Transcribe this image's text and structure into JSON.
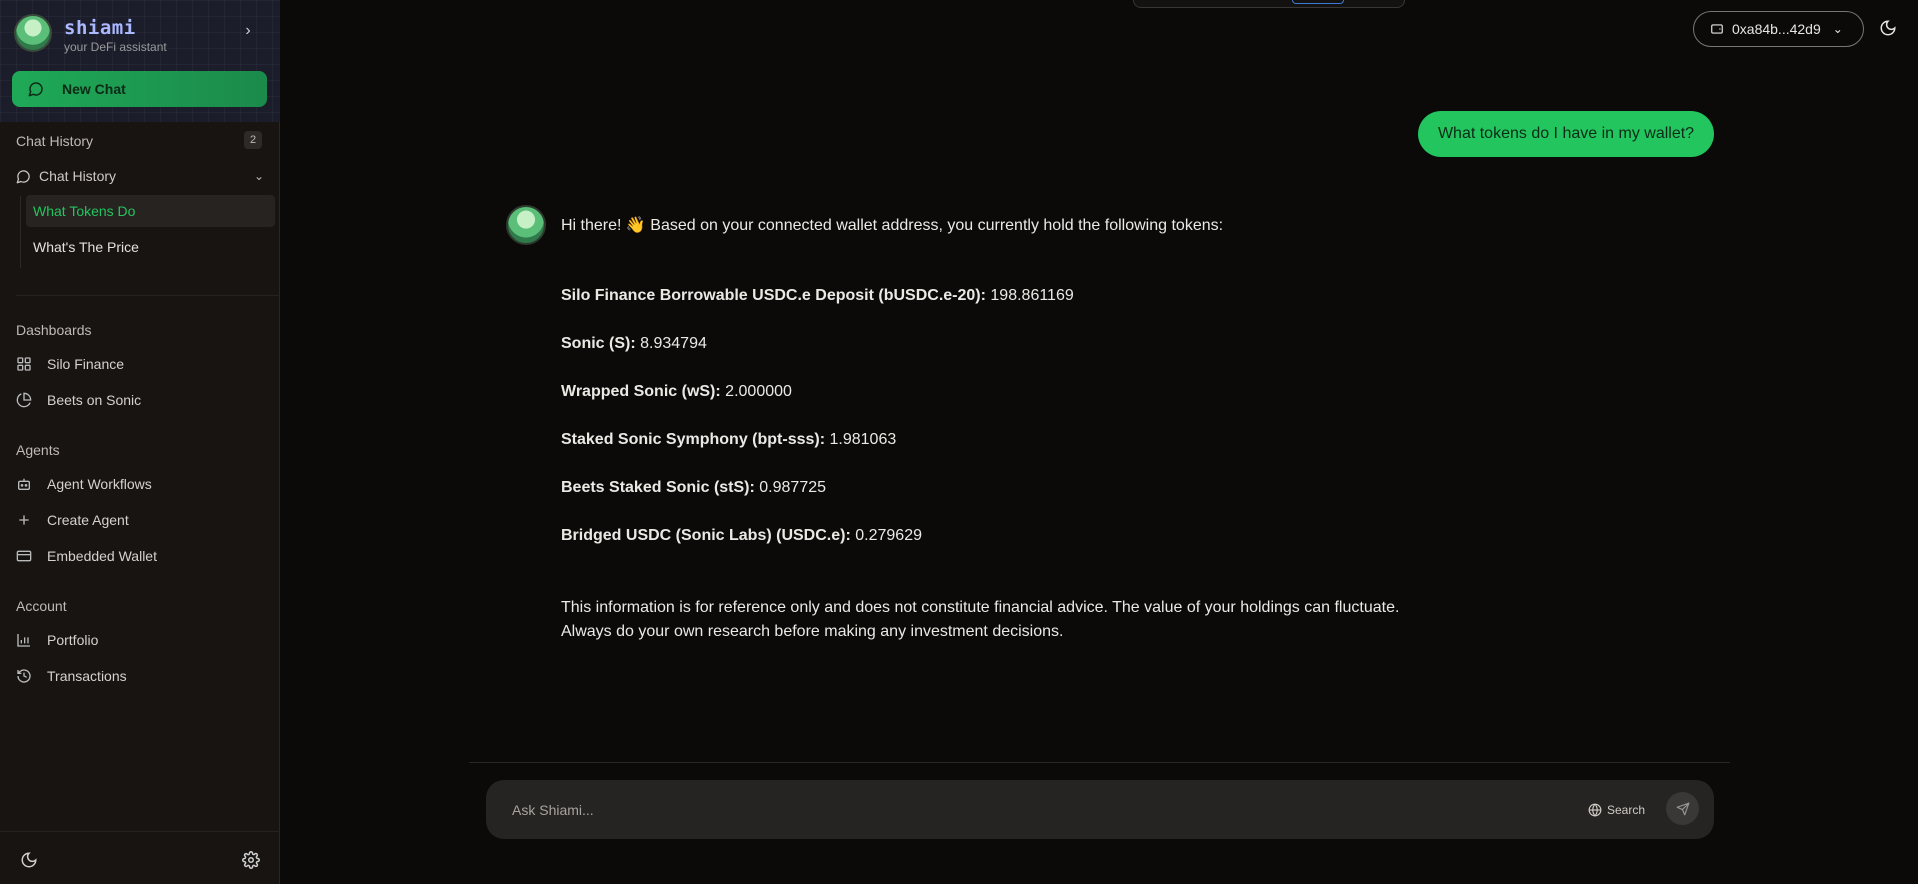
{
  "brand": {
    "name": "shiami",
    "subtitle": "your DeFi assistant"
  },
  "sidebar": {
    "new_chat_label": "New Chat",
    "chat_history_section": "Chat History",
    "chat_history_count": "2",
    "chat_history_group": "Chat History",
    "history_items": [
      {
        "label": "What Tokens Do",
        "active": true
      },
      {
        "label": "What's The Price",
        "active": false
      }
    ],
    "dashboards_label": "Dashboards",
    "dashboards": [
      {
        "label": "Silo Finance",
        "icon": "grid-icon"
      },
      {
        "label": "Beets on Sonic",
        "icon": "pie-chart-icon"
      }
    ],
    "agents_label": "Agents",
    "agents": [
      {
        "label": "Agent Workflows",
        "icon": "bot-icon"
      },
      {
        "label": "Create Agent",
        "icon": "plus-icon"
      },
      {
        "label": "Embedded Wallet",
        "icon": "card-icon"
      }
    ],
    "account_label": "Account",
    "account": [
      {
        "label": "Portfolio",
        "icon": "bar-chart-icon"
      },
      {
        "label": "Transactions",
        "icon": "history-icon"
      }
    ]
  },
  "header": {
    "wallet_address": "0xa84b...42d9"
  },
  "chat": {
    "user_message": "What tokens do I have in my wallet?",
    "bot_intro": "Hi there! 👋  Based on your connected wallet address, you currently hold the following tokens:",
    "tokens": [
      {
        "name": "Silo Finance Borrowable USDC.e Deposit (bUSDC.e-20):",
        "amount": "198.861169"
      },
      {
        "name": "Sonic (S):",
        "amount": "8.934794"
      },
      {
        "name": "Wrapped Sonic (wS):",
        "amount": "2.000000"
      },
      {
        "name": "Staked Sonic Symphony (bpt-sss):",
        "amount": "1.981063"
      },
      {
        "name": "Beets Staked Sonic (stS):",
        "amount": "0.987725"
      },
      {
        "name": "Bridged USDC (Sonic Labs) (USDC.e):",
        "amount": "0.279629"
      }
    ],
    "disclaimer_line1": "This information is for reference only and does not constitute financial advice.  The value of your holdings can fluctuate.",
    "disclaimer_line2": "Always do your own research before making any investment decisions."
  },
  "composer": {
    "placeholder": "Ask Shiami...",
    "search_label": "Search"
  },
  "colors": {
    "accent": "#22c55e",
    "brand_text": "#aab8ff",
    "background": "#0b0a09",
    "sidebar": "#171412"
  }
}
